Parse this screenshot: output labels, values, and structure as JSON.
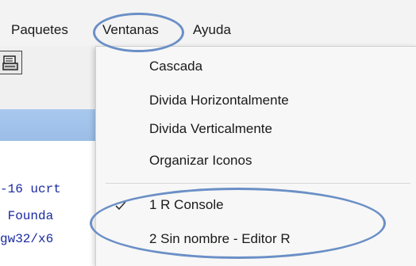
{
  "menubar": {
    "items": [
      {
        "label": "Paquetes"
      },
      {
        "label": "Ventanas"
      },
      {
        "label": "Ayuda"
      }
    ]
  },
  "console": {
    "lines": [
      "-16 ucrt",
      " Founda",
      "gw32/x6"
    ]
  },
  "dropdown": {
    "items": [
      {
        "label": "Cascada"
      },
      {
        "label": "Divida Horizontalmente"
      },
      {
        "label": "Divida Verticalmente"
      },
      {
        "label": "Organizar Iconos"
      },
      {
        "label": "1 R Console",
        "checked": true
      },
      {
        "label": "2 Sin nombre - Editor R"
      }
    ]
  },
  "colors": {
    "annotation": "#6a8fc6",
    "console_text": "#1a2aa0",
    "titlebar": "#a8c8ee"
  },
  "icons": {
    "toolbar": "print-icon",
    "checkmark": "checkmark-icon"
  }
}
